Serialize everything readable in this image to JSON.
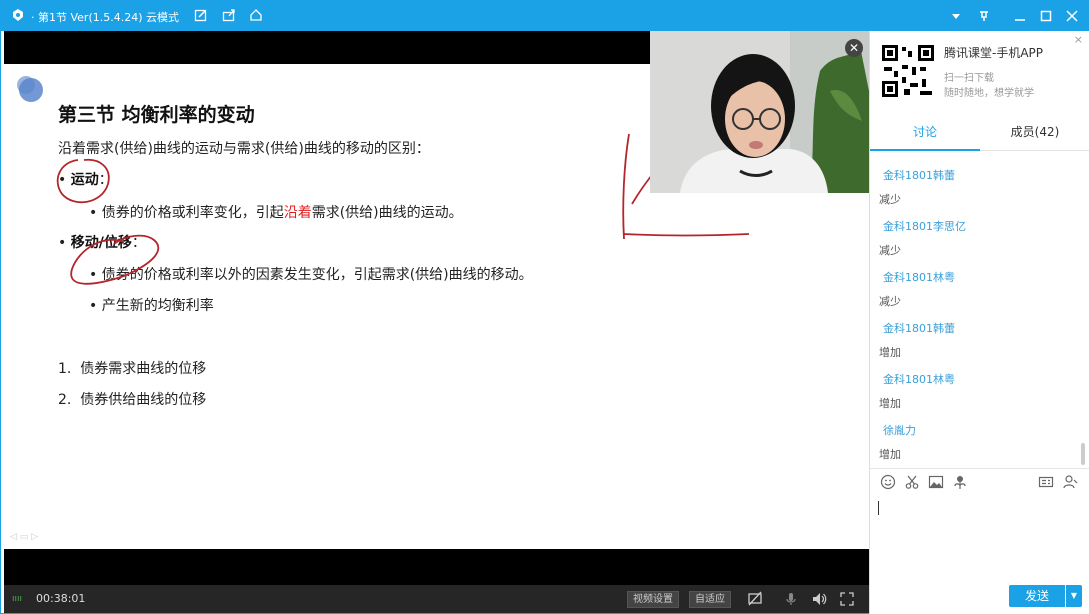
{
  "window": {
    "title": "· 第1节 Ver(1.5.4.24)  云模式",
    "icons": [
      "app-logo-icon",
      "edit-icon",
      "share-icon",
      "home-icon"
    ],
    "controls": [
      "dropdown-icon",
      "pin-icon",
      "minimize-icon",
      "maximize-icon",
      "close-icon"
    ]
  },
  "slide": {
    "title": "第三节  均衡利率的变动",
    "intro": "沿着需求(供给)曲线的运动与需求(供给)曲线的移动的区别：",
    "bullet1_label": "运动",
    "bullet1_colon": "：",
    "bullet1_sub_pre": "债券的价格或利率变化，引起",
    "bullet1_sub_red": "沿着",
    "bullet1_sub_post": "需求(供给)曲线的运动。",
    "bullet2_label": "移动/位移",
    "bullet2_colon": "：",
    "bullet2_sub1": "债券的价格或利率以外的因素发生变化，引起需求(供给)曲线的移动。",
    "bullet2_sub2": "产生新的均衡利率",
    "list1_num": "1.",
    "list1": "债券需求曲线的位移",
    "list2_num": "2.",
    "list2": "债券供给曲线的位移",
    "bullet_char": "•",
    "nav": "◁ ▭ ▷"
  },
  "webcam": {
    "close_symbol": "✕"
  },
  "controlbar": {
    "signal": "ıııı",
    "time": "00:38:01",
    "video_settings": "视频设置",
    "adaptive": "自适应",
    "icons": [
      "screen-off-icon",
      "microphone-icon",
      "volume-icon",
      "fullscreen-icon"
    ]
  },
  "panel": {
    "close_symbol": "×",
    "promo_title": "腾讯课堂-手机APP",
    "promo_line1": "扫一扫下载",
    "promo_line2": "随时随地，想学就学",
    "tabs": [
      "讨论",
      "成员(42)"
    ],
    "messages": [
      {
        "name": "金科1801韩蕾",
        "text": "减少"
      },
      {
        "name": "金科1801李思亿",
        "text": "减少"
      },
      {
        "name": "金科1801林粤",
        "text": "减少"
      },
      {
        "name": "金科1801韩蕾",
        "text": "增加"
      },
      {
        "name": "金科1801林粤",
        "text": "增加"
      },
      {
        "name": "徐胤力",
        "text": "增加"
      }
    ],
    "toolbar_icons": [
      "emoji-icon",
      "scissors-icon",
      "image-icon",
      "flower-icon",
      "card-icon",
      "person-icon"
    ],
    "send": "发送",
    "send_arrow": "▼"
  },
  "colors": {
    "accent": "#1aa1e6",
    "red_text": "#e02020",
    "chat_name": "#3aa0d8"
  }
}
